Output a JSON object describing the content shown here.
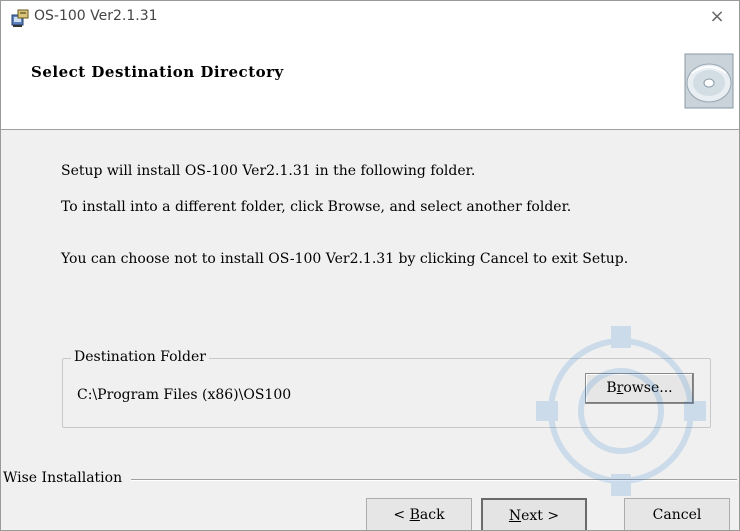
{
  "window": {
    "title": "OS-100 Ver2.1.31",
    "close_glyph": "×"
  },
  "header": {
    "title": "Select Destination Directory",
    "art_icon": "cd-disc-icon"
  },
  "body": {
    "line1": "Setup will install OS-100 Ver2.1.31 in the following folder.",
    "line2": "To install into a different folder, click Browse, and select another folder.",
    "line3": "You can choose not to install OS-100 Ver2.1.31 by clicking Cancel to exit Setup."
  },
  "destination": {
    "group_label": "Destination Folder",
    "path": "C:\\Program Files (x86)\\OS100",
    "browse_pre": "B",
    "browse_ul": "r",
    "browse_post": "owse..."
  },
  "footer": {
    "brand_label": "Wise Installation",
    "back_pre": "< ",
    "back_ul": "B",
    "back_post": "ack",
    "next_ul": "N",
    "next_post": "ext >",
    "cancel_label": "Cancel"
  },
  "colors": {
    "window_bg": "#f0f0f0",
    "header_bg": "#ffffff",
    "watermark": "#2a7fd4"
  }
}
